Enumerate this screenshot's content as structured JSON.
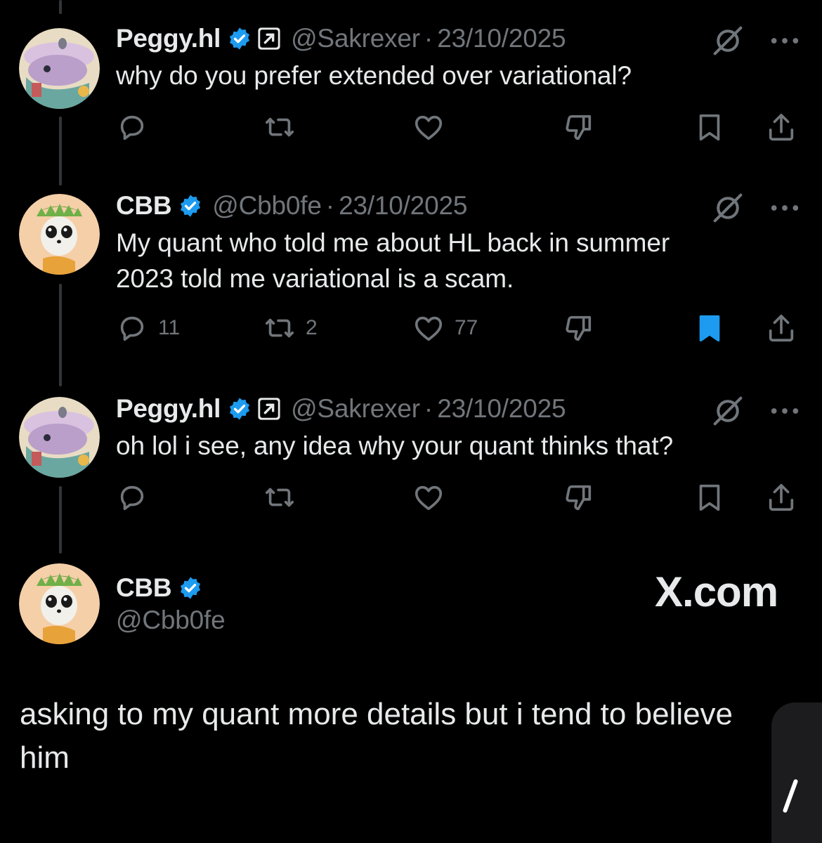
{
  "tweets": [
    {
      "name": "Peggy.hl",
      "handle": "@Sakrexer",
      "sep": "·",
      "date": "23/10/2025",
      "text": "why do you prefer extended over variational?",
      "counts": {
        "reply": "",
        "repost": "",
        "like": ""
      },
      "bookmarked": false,
      "affiliate": true
    },
    {
      "name": "CBB",
      "handle": "@Cbb0fe",
      "sep": "·",
      "date": "23/10/2025",
      "text": "My quant who told me about HL back in summer 2023 told me variational is a scam.",
      "counts": {
        "reply": "11",
        "repost": "2",
        "like": "77"
      },
      "bookmarked": true,
      "affiliate": false
    },
    {
      "name": "Peggy.hl",
      "handle": "@Sakrexer",
      "sep": "·",
      "date": "23/10/2025",
      "text": "oh lol i see, any idea why your quant thinks that?",
      "counts": {
        "reply": "",
        "repost": "",
        "like": ""
      },
      "bookmarked": false,
      "affiliate": true
    }
  ],
  "final": {
    "name": "CBB",
    "handle": "@Cbb0fe",
    "text": "asking to my quant more details but i tend to believe him",
    "watermark": "X.com"
  },
  "colors": {
    "verified": "#1d9bf0",
    "bookmark_active": "#1d9bf0",
    "muted": "#71767b"
  },
  "icons": [
    "reply-icon",
    "repost-icon",
    "like-icon",
    "dislike-icon",
    "bookmark-icon",
    "share-icon",
    "grok-icon",
    "more-icon",
    "verified-badge-icon",
    "affiliate-icon"
  ]
}
